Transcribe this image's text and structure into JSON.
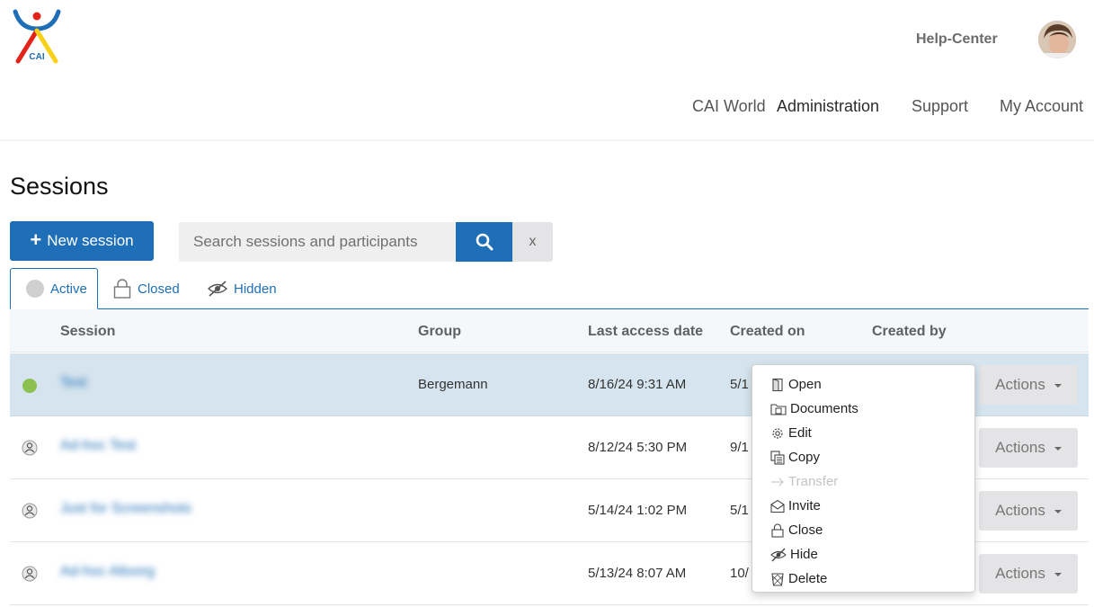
{
  "header": {
    "logo_text": "CAI",
    "help_center": "Help-Center",
    "nav": [
      "CAI World",
      "Administration",
      "Support",
      "My Account"
    ]
  },
  "page": {
    "title": "Sessions"
  },
  "toolbar": {
    "new_session": "New session",
    "search_placeholder": "Search sessions and participants",
    "clear_label": "x"
  },
  "tabs": [
    {
      "label": "Active",
      "icon": "status-circle-icon"
    },
    {
      "label": "Closed",
      "icon": "lock-icon"
    },
    {
      "label": "Hidden",
      "icon": "eye-slash-icon"
    }
  ],
  "table": {
    "columns": [
      "Session",
      "Group",
      "Last access date",
      "Created on",
      "Created by"
    ],
    "rows": [
      {
        "session": "Test",
        "group": "Bergemann",
        "last_access": "8/16/24 9:31 AM",
        "created_on": "5/1",
        "actions": "Actions",
        "status": "active"
      },
      {
        "session": "Ad-hoc Test",
        "group": "",
        "last_access": "8/12/24 5:30 PM",
        "created_on": "9/1",
        "actions": "Actions",
        "status": "idle"
      },
      {
        "session": "Just for Screenshots",
        "group": "",
        "last_access": "5/14/24 1:02 PM",
        "created_on": "5/1",
        "actions": "Actions",
        "status": "idle"
      },
      {
        "session": "Ad-hoc Altoorg",
        "group": "",
        "last_access": "5/13/24 8:07 AM",
        "created_on": "10/",
        "actions": "Actions",
        "status": "idle"
      }
    ]
  },
  "actions_menu": {
    "items": [
      {
        "label": "Open",
        "icon": "door-icon"
      },
      {
        "label": "Documents",
        "icon": "folder-icon"
      },
      {
        "label": "Edit",
        "icon": "gear-icon"
      },
      {
        "label": "Copy",
        "icon": "copy-icon"
      },
      {
        "label": "Transfer",
        "icon": "arrow-right-icon",
        "disabled": true
      },
      {
        "label": "Invite",
        "icon": "envelope-icon"
      },
      {
        "label": "Close",
        "icon": "lock-icon"
      },
      {
        "label": "Hide",
        "icon": "eye-slash-icon"
      },
      {
        "label": "Delete",
        "icon": "trash-icon"
      }
    ]
  },
  "colors": {
    "primary": "#1e6fb8",
    "active_status": "#8cc152",
    "selected_row": "#d5e4ee",
    "logo_blue": "#1e6fb8",
    "logo_red": "#e2231a",
    "logo_yellow": "#f7d117"
  }
}
